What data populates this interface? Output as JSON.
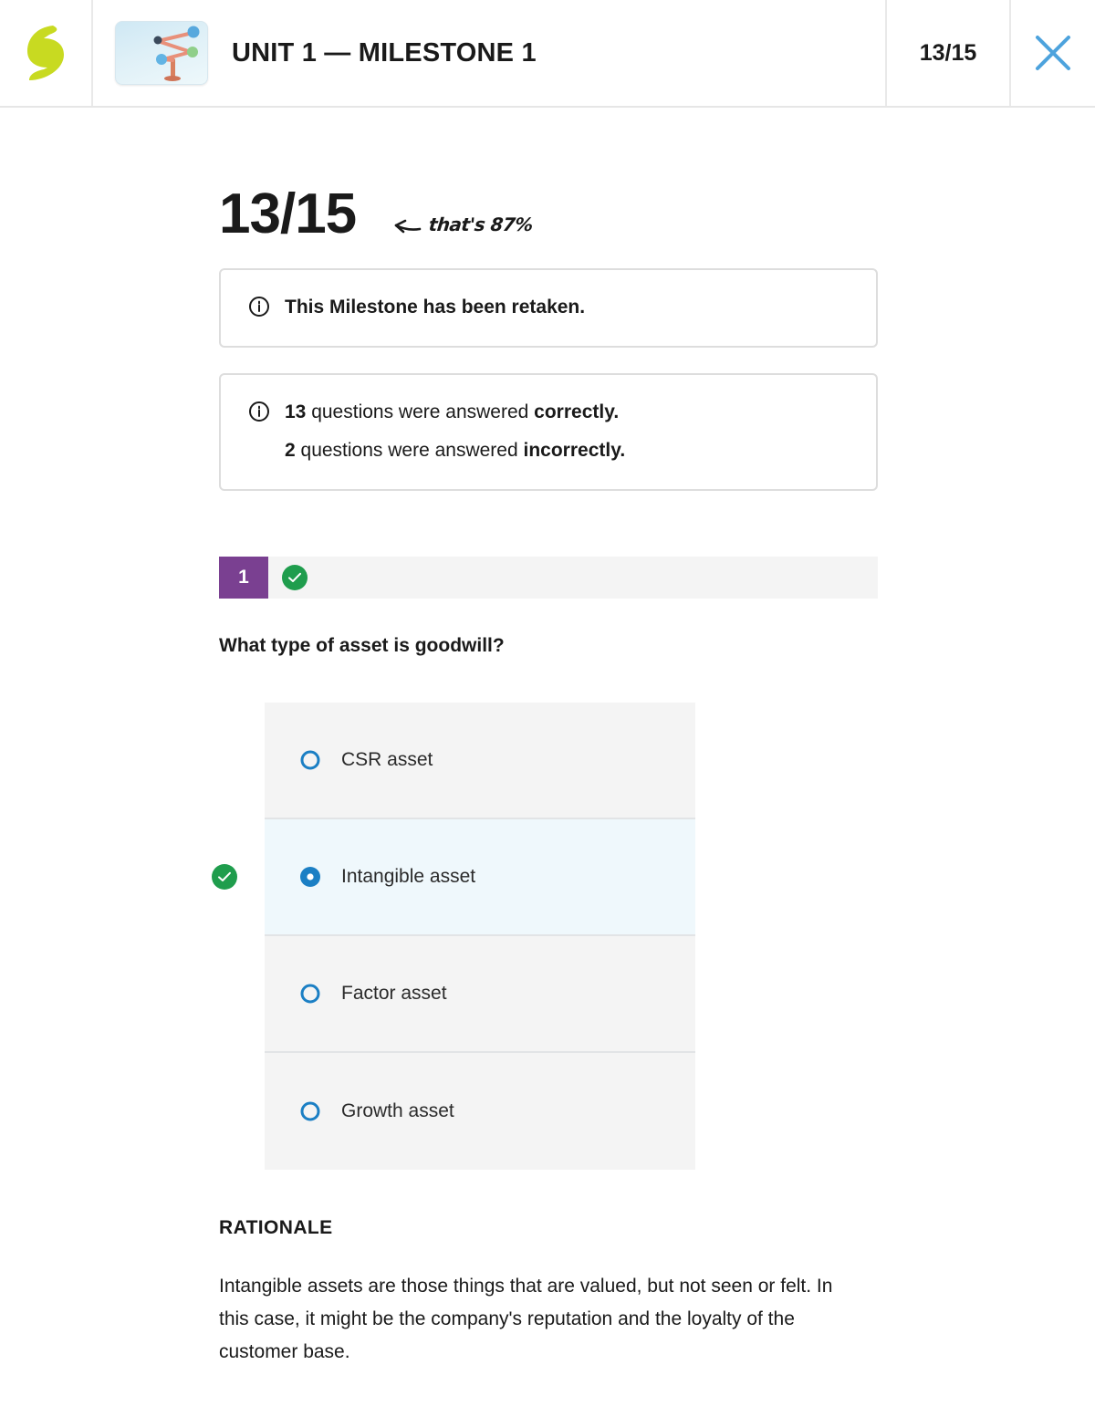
{
  "header": {
    "logo_name": "sophia-logo",
    "thumbnail_name": "balance-scale-illustration",
    "title": "UNIT 1 — MILESTONE 1",
    "score": "13/15",
    "close_label": "close-icon"
  },
  "summary": {
    "big_score": "13/15",
    "annotation": "that's 87%",
    "notices": [
      {
        "icon": "info-icon",
        "lines": [
          [
            {
              "text": "This Milestone has been retaken.",
              "bold": true
            }
          ]
        ]
      },
      {
        "icon": "info-icon",
        "lines": [
          [
            {
              "text": "13",
              "bold": true
            },
            {
              "text": " questions were answered ",
              "bold": false
            },
            {
              "text": "correctly.",
              "bold": true
            }
          ],
          [
            {
              "text": "2",
              "bold": true
            },
            {
              "text": " questions were answered ",
              "bold": false
            },
            {
              "text": "incorrectly.",
              "bold": true
            }
          ]
        ]
      }
    ]
  },
  "question": {
    "number": "1",
    "status_icon": "check-circle-icon",
    "text": "What type of asset is goodwill?",
    "options": [
      {
        "label": "CSR asset",
        "selected": false,
        "correct": false
      },
      {
        "label": "Intangible asset",
        "selected": true,
        "correct": true
      },
      {
        "label": "Factor asset",
        "selected": false,
        "correct": false
      },
      {
        "label": "Growth asset",
        "selected": false,
        "correct": false
      }
    ],
    "rationale_heading": "RATIONALE",
    "rationale_text": "Intangible assets are those things that are valued, but not seen or felt. In this case, it might be the company's reputation and the loyalty of the customer base."
  },
  "colors": {
    "accent_purple": "#7a4091",
    "accent_green": "#1f9d4d",
    "accent_blue": "#1b7fc4",
    "logo_green": "#c8da21",
    "selected_row": "#eff8fc"
  }
}
